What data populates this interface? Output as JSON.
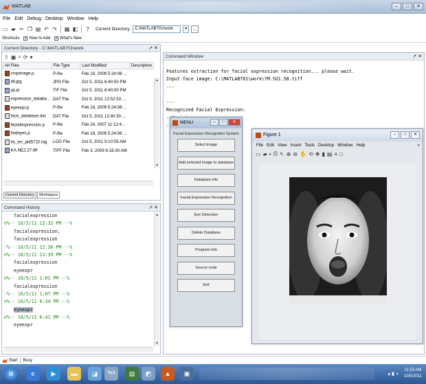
{
  "window": {
    "title": "MATLAB",
    "min": "–",
    "max": "□",
    "close": "✕"
  },
  "menubar": [
    "File",
    "Edit",
    "Debug",
    "Desktop",
    "Window",
    "Help"
  ],
  "toolbar": {
    "current_dir_label": "Current Directory:",
    "current_dir_value": "C:\\MATLAB701\\work",
    "dropdown": "▾",
    "browse": "…"
  },
  "shortcuts": {
    "label": "Shortcuts",
    "items": [
      "How to Add",
      "What's New"
    ]
  },
  "current_directory": {
    "header": "Current Directory - C:\\MATLAB701\\work",
    "columns": [
      "All Files",
      "File Type",
      "Last Modified",
      "Description"
    ],
    "files": [
      {
        "name": "cropimage.p",
        "type": "P-file",
        "modified": "Feb 18, 2009 5:24:08 ...",
        "icon": "p"
      },
      {
        "name": "dil.jpg",
        "type": "JPG File",
        "modified": "Oct 5, 2011 6:40:50 PM",
        "icon": "img"
      },
      {
        "name": "dil.tif",
        "type": "TIF File",
        "modified": "Oct 5, 2011 6:40:00 PM",
        "icon": "img"
      },
      {
        "name": "expression_databa...",
        "type": "DAT File",
        "modified": "Oct 5, 2011 12:52:53 ...",
        "icon": "dat"
      },
      {
        "name": "eyeexpr.p",
        "type": "P-file",
        "modified": "Feb 18, 2009 5:24:08 ...",
        "icon": "p"
      },
      {
        "name": "face_database.dat",
        "type": "DAT File",
        "modified": "Oct 5, 2011 12:40:30 ...",
        "icon": "dat"
      },
      {
        "name": "facialexpression.p",
        "type": "P-file",
        "modified": "Feb 24, 2007 11:12:4...",
        "icon": "p"
      },
      {
        "name": "findeyes.p",
        "type": "P-file",
        "modified": "Feb 18, 2009 5:24:08 ...",
        "icon": "p"
      },
      {
        "name": "hs_err_pid5720.log",
        "type": "LOG File",
        "modified": "Oct 5, 2011 9:10:55 AM",
        "icon": "dat"
      },
      {
        "name": "KA.NE2.27.tiff",
        "type": "TIFF File",
        "modified": "Feb 3, 2009 6:16:30 AM",
        "icon": "img"
      }
    ],
    "tabs": [
      "Current Directory",
      "Workspace"
    ]
  },
  "command_history": {
    "header": "Command History",
    "rows": [
      {
        "kind": "cmd",
        "text": "facialexpression"
      },
      {
        "kind": "session",
        "text": "⊟%-- 10/5/11 12:32 PM --%"
      },
      {
        "kind": "cmd",
        "text": "facialexpression;"
      },
      {
        "kind": "cmd",
        "text": "facialexpression"
      },
      {
        "kind": "session",
        "text": "-%-- 10/5/11 12:36 PM --%"
      },
      {
        "kind": "session",
        "text": "⊟%-- 10/5/11 12:39 PM --%"
      },
      {
        "kind": "cmd",
        "text": "facialexpression"
      },
      {
        "kind": "cmd",
        "text": "eyeexpr"
      },
      {
        "kind": "session",
        "text": "⊟%-- 10/5/11 1:01 PM --%"
      },
      {
        "kind": "cmd",
        "text": "facialexpression"
      },
      {
        "kind": "session",
        "text": "-%-- 10/5/11 1:07 PM --%"
      },
      {
        "kind": "session",
        "text": "⊟%-- 10/5/11 6:34 PM --%"
      },
      {
        "kind": "cmd",
        "text": "eyeexpr",
        "selected": true
      },
      {
        "kind": "session",
        "text": "⊟%-- 10/5/11 6:41 PM --%"
      },
      {
        "kind": "cmd",
        "text": "eyeexpr"
      }
    ]
  },
  "command_window": {
    "header": "Command Window",
    "lines": [
      "Features extraction for facial expression recognition... please wait.",
      "Input face image: C:\\MATLAB701\\work\\YM.SU1.58.tiff",
      "---",
      "",
      "---",
      "Recognized Facial Expression:",
      "- Surprise",
      "---"
    ]
  },
  "menu_window": {
    "title": "MENU",
    "heading": "Facial Expression Recognition System",
    "buttons": [
      "Select image",
      "Add selected image to database",
      "Database info",
      "Facial Expression Recognition",
      "Eye Detection",
      "Delete Database",
      "Program info",
      "Source code",
      "Exit"
    ]
  },
  "figure_window": {
    "title": "Figure 1",
    "menu": [
      "File",
      "Edit",
      "View",
      "Insert",
      "Tools",
      "Desktop",
      "Window",
      "Help"
    ],
    "menu_arrow": "»"
  },
  "statusbar": {
    "start": "Start",
    "status": "Busy"
  },
  "taskbar": {
    "clock_time": "11:53 AM",
    "clock_date": "10/5/2011"
  },
  "colors": {
    "taskbar": "#2b5795",
    "session_green": "#178a17",
    "matlab_orange": "#c24a10"
  }
}
